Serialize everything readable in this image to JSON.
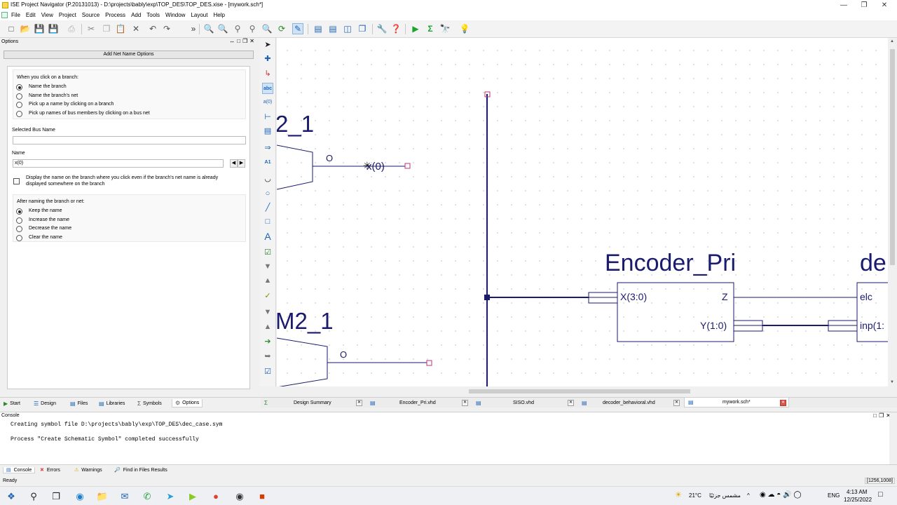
{
  "window": {
    "title": "ISE Project Navigator (P.20131013) - D:\\projects\\bably\\exp\\TOP_DES\\TOP_DES.xise - [mywork.sch*]"
  },
  "menu": [
    "File",
    "Edit",
    "View",
    "Project",
    "Source",
    "Process",
    "Add",
    "Tools",
    "Window",
    "Layout",
    "Help"
  ],
  "options_panel": {
    "title": "Options",
    "header_button": "Add Net Name Options",
    "branch_group": {
      "label": "When you click on a branch:",
      "options": [
        "Name the branch",
        "Name the branch's net",
        "Pick up a name by clicking on a branch",
        "Pick up names of bus members by clicking on a bus net"
      ],
      "selected": 0
    },
    "selected_bus_label": "Selected Bus Name",
    "selected_bus_value": "",
    "name_label": "Name",
    "name_value": "x(0)",
    "display_checkbox_label": "Display the name on the branch where you click even if the branch's net name is already displayed somewhere on the branch",
    "display_checked": false,
    "after_group": {
      "label": "After naming the branch or net:",
      "options": [
        "Keep the name",
        "Increase the name",
        "Decrease the name",
        "Clear the name"
      ],
      "selected": 0
    }
  },
  "left_tabs": [
    "Start",
    "Design",
    "Files",
    "Libraries",
    "Symbols",
    "Options"
  ],
  "left_tab_active": "Options",
  "schematic": {
    "sym_top_label": "2_1",
    "sym_top_pin": "O",
    "net_label": "x(0)",
    "sym_bottom_label": "M2_1",
    "sym_bottom_pin": "O",
    "encoder_title": "Encoder_Pri",
    "encoder_in": "X(3:0)",
    "encoder_out_z": "Z",
    "encoder_out_y": "Y(1:0)",
    "decoder_title": "de",
    "decoder_in1": "elc",
    "decoder_in2": "inp(1:"
  },
  "doc_tabs": [
    "Design Summary",
    "Encoder_Pri.vhd",
    "SISO.vhd",
    "decoder_behavioral.vhd",
    "mywork.sch*"
  ],
  "doc_tab_active": "mywork.sch*",
  "console": {
    "title": "Console",
    "lines": [
      "Creating symbol file D:\\projects\\bably\\exp\\TOP_DES\\dec_case.sym",
      "Process \"Create Schematic Symbol\" completed successfully"
    ]
  },
  "console_tabs": [
    "Console",
    "Errors",
    "Warnings",
    "Find in Files Results"
  ],
  "status": {
    "text": "Ready",
    "coords": "[1256,1008]"
  },
  "taskbar": {
    "weather": "21°C",
    "weather_text": "مشمس جزئيًا",
    "lang": "ENG",
    "time": "4:13 AM",
    "date": "12/25/2022"
  }
}
